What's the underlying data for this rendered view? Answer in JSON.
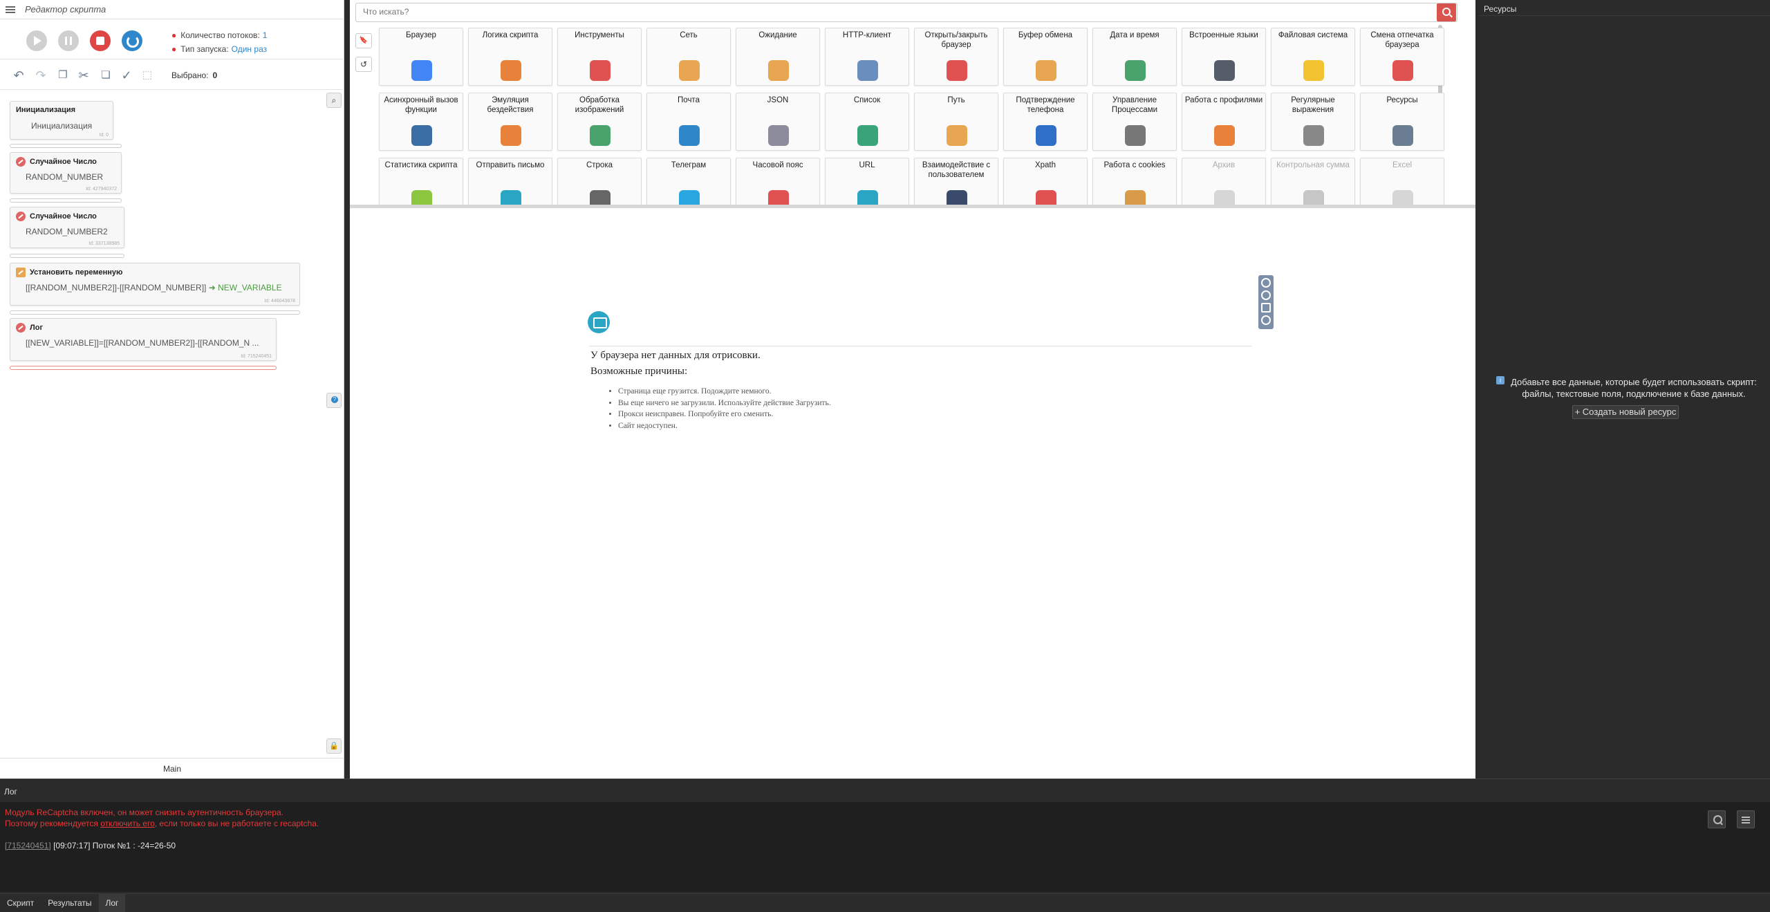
{
  "left_panel": {
    "title": "Редактор скрипта",
    "threads_label": "Количество потоков:",
    "threads_value": "1",
    "launch_label": "Тип запуска:",
    "launch_value": "Один раз",
    "selected_label": "Выбрано:",
    "selected_value": "0",
    "footer_label": "Main"
  },
  "blocks": [
    {
      "title": "Инициализация",
      "body": "Инициализация",
      "id": "Id: 0"
    },
    {
      "title": "Случайное Число",
      "body": "RANDOM_NUMBER",
      "id": "Id: 427940372"
    },
    {
      "title": "Случайное Число",
      "body": "RANDOM_NUMBER2",
      "id": "Id: 337138985"
    },
    {
      "title": "Установить переменную",
      "body": "[[RANDOM_NUMBER2]]-[[RANDOM_NUMBER]]",
      "var": "NEW_VARIABLE",
      "id": "Id: 446043878"
    },
    {
      "title": "Лог",
      "body": "[[NEW_VARIABLE]]=[[RANDOM_NUMBER2]]-[[RANDOM_N ...",
      "id": "Id: 715240451"
    }
  ],
  "toolbox": {
    "search_placeholder": "Что искать?",
    "tools": [
      {
        "label": "Браузер",
        "icon": "chrome-icon",
        "color": "#4285f4"
      },
      {
        "label": "Логика скрипта",
        "icon": "logic-icon",
        "color": "#e8823a"
      },
      {
        "label": "Инструменты",
        "icon": "wrench-icon",
        "color": "#e05252"
      },
      {
        "label": "Сеть",
        "icon": "antenna-icon",
        "color": "#e8a552"
      },
      {
        "label": "Ожидание",
        "icon": "hourglass-icon",
        "color": "#e8a552"
      },
      {
        "label": "HTTP-клиент",
        "icon": "http-icon",
        "color": "#6a8fbf"
      },
      {
        "label": "Открыть/закрыть браузер",
        "icon": "power-icon",
        "color": "#e05252"
      },
      {
        "label": "Буфер обмена",
        "icon": "clipboard-icon",
        "color": "#e8a552"
      },
      {
        "label": "Дата и время",
        "icon": "calendar-icon",
        "color": "#4aa36b"
      },
      {
        "label": "Встроенные языки",
        "icon": "code-icon",
        "color": "#555d6b"
      },
      {
        "label": "Файловая система",
        "icon": "folder-icon",
        "color": "#f2c230"
      },
      {
        "label": "Смена отпечатка браузера",
        "icon": "fingerprint-icon",
        "color": "#e05252"
      },
      {
        "label": "Асинхронный вызов функции",
        "icon": "async-icon",
        "color": "#3a6ea5"
      },
      {
        "label": "Эмуляция бездействия",
        "icon": "clock-icon",
        "color": "#e8823a"
      },
      {
        "label": "Обработка изображений",
        "icon": "image-icon",
        "color": "#4aa36b"
      },
      {
        "label": "Почта",
        "icon": "mail-icon",
        "color": "#2f86c8"
      },
      {
        "label": "JSON",
        "icon": "json-icon",
        "color": "#8c8c9c"
      },
      {
        "label": "Список",
        "icon": "list-icon",
        "color": "#3aa37a"
      },
      {
        "label": "Путь",
        "icon": "path-icon",
        "color": "#e8a552"
      },
      {
        "label": "Подтверждение телефона",
        "icon": "phone-icon",
        "color": "#2f6fc8"
      },
      {
        "label": "Управление Процессами",
        "icon": "exe-icon",
        "color": "#777"
      },
      {
        "label": "Работа с профилями",
        "icon": "profile-icon",
        "color": "#e8823a"
      },
      {
        "label": "Регулярные выражения",
        "icon": "regex-icon",
        "color": "#888"
      },
      {
        "label": "Ресурсы",
        "icon": "resources-icon",
        "color": "#6a7d92"
      },
      {
        "label": "Статистика скрипта",
        "icon": "pie-icon",
        "color": "#8cc63f"
      },
      {
        "label": "Отправить письмо",
        "icon": "send-mail-icon",
        "color": "#2aa6c4"
      },
      {
        "label": "Строка",
        "icon": "txt-icon",
        "color": "#666"
      },
      {
        "label": "Телеграм",
        "icon": "telegram-icon",
        "color": "#2aa6e0"
      },
      {
        "label": "Часовой пояс",
        "icon": "timezone-icon",
        "color": "#e05252"
      },
      {
        "label": "URL",
        "icon": "link-icon",
        "color": "#2aa6c4"
      },
      {
        "label": "Взаимодействие с пользователем",
        "icon": "user-icon",
        "color": "#3a4a6b"
      },
      {
        "label": "Xpath",
        "icon": "xpath-icon",
        "color": "#e05252"
      },
      {
        "label": "Работа с cookies",
        "icon": "cookie-icon",
        "color": "#d89b4a"
      },
      {
        "label": "Архив",
        "icon": "archive-icon",
        "color": "#aaa",
        "dim": true
      },
      {
        "label": "Контрольная сумма",
        "icon": "hash-icon",
        "color": "#888",
        "dim": true
      },
      {
        "label": "Excel",
        "icon": "excel-icon",
        "color": "#aaa",
        "dim": true
      }
    ]
  },
  "browser": {
    "heading": "У браузера нет данных для отрисовки.",
    "reasons_title": "Возможные причины:",
    "reasons": [
      "Страница еще грузится. Подождите немного.",
      "Вы еще ничего не загрузили. Используйте действие Загрузить.",
      "Прокси неисправен. Попробуйте его сменить.",
      "Сайт недоступен."
    ]
  },
  "resources": {
    "title": "Ресурсы",
    "info": "Добавьте все данные, которые будет использовать скрипт: файлы, текстовые поля, подключение к базе данных.",
    "create_button": "+ Создать новый ресурс"
  },
  "log": {
    "title": "Лог",
    "line1": "Модуль ReCaptcha включен, он может снизить аутентичность браузера.",
    "line2_prefix": "Поэтому рекомендуется ",
    "line2_link": "отключить его",
    "line2_suffix": ", если только вы не работаете с recaptcha.",
    "line3_id": "[715240451]",
    "line3_text": " [09:07:17] Поток №1 : -24=26-50"
  },
  "bottom_tabs": [
    "Скрипт",
    "Результаты",
    "Лог"
  ],
  "colors": {
    "accent_blue": "#2f86c8",
    "stop_red": "#e04545",
    "log_red": "#e23a3a",
    "var_green": "#4a9c3f"
  }
}
